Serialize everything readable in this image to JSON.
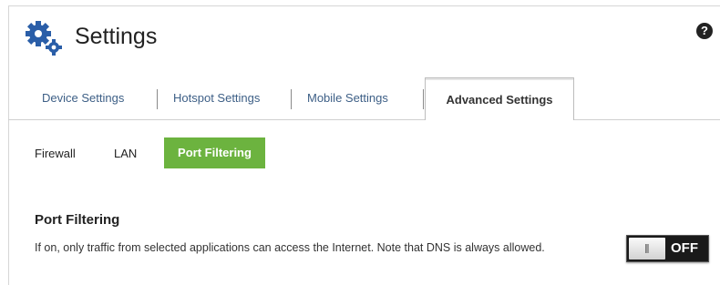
{
  "header": {
    "title": "Settings",
    "icon": "gears-icon",
    "help_icon": "help-icon",
    "help_glyph": "?"
  },
  "tabs": [
    {
      "label": "Device Settings",
      "active": false
    },
    {
      "label": "Hotspot Settings",
      "active": false
    },
    {
      "label": "Mobile Settings",
      "active": false
    },
    {
      "label": "Advanced Settings",
      "active": true
    }
  ],
  "subtabs": [
    {
      "label": "Firewall",
      "active": false
    },
    {
      "label": "LAN",
      "active": false
    },
    {
      "label": "Port Filtering",
      "active": true
    }
  ],
  "section": {
    "title": "Port Filtering",
    "description": "If on, only traffic from selected applications can access the Internet. Note that DNS is always allowed.",
    "toggle_label": "OFF",
    "toggle_on": false
  },
  "colors": {
    "accent_green": "#6cb33f",
    "tab_text": "#3d5f86",
    "icon_blue": "#2a5ea8"
  }
}
